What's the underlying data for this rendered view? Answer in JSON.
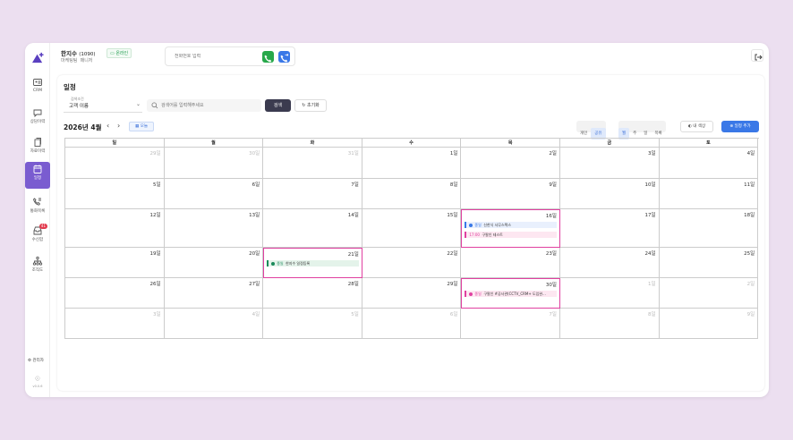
{
  "sidebar": {
    "items": [
      {
        "icon": "contact-card-icon",
        "label": "CRM"
      },
      {
        "icon": "chat-bubble-icon",
        "label": "상담이력"
      },
      {
        "icon": "document-copy-icon",
        "label": "자료이력"
      },
      {
        "icon": "calendar-icon",
        "label": "일정"
      },
      {
        "icon": "phone-list-icon",
        "label": "통화목록"
      },
      {
        "icon": "inbox-icon",
        "label": "수신함",
        "badge": "41"
      },
      {
        "icon": "org-chart-icon",
        "label": "조직도"
      }
    ],
    "admin_label": "관리자",
    "version_label": "v0.0.6",
    "active_index": 3
  },
  "header": {
    "user_name": "한지수",
    "user_ext": "(1090)",
    "user_team": "마케팅팀",
    "user_role": "매니저",
    "status": "온라인",
    "dial_placeholder": "전화번호 입력"
  },
  "page": {
    "title": "일정",
    "condition_label": "검색조건",
    "condition_value": "고객 이름",
    "search_placeholder": "검색어를 입력해주세요",
    "search_btn": "검색",
    "reset_btn": "초기화",
    "month_label": "2026년 4월",
    "prev": "‹",
    "next": "›",
    "today_btn": "오늘",
    "scope_tabs": [
      {
        "label": "개인",
        "on": false
      },
      {
        "label": "공유",
        "on": true
      }
    ],
    "view_tabs": [
      {
        "label": "월",
        "on": true
      },
      {
        "label": "주",
        "on": false
      },
      {
        "label": "일",
        "on": false
      },
      {
        "label": "목록",
        "on": false
      }
    ],
    "color_btn": "내 색상",
    "add_btn": "일정 추가"
  },
  "calendar": {
    "weekdays": [
      "일",
      "월",
      "화",
      "수",
      "목",
      "금",
      "토"
    ],
    "weeks": [
      [
        {
          "d": "29일",
          "o": true
        },
        {
          "d": "30일",
          "o": true
        },
        {
          "d": "31일",
          "o": true
        },
        {
          "d": "1일"
        },
        {
          "d": "2일"
        },
        {
          "d": "3일"
        },
        {
          "d": "4일"
        }
      ],
      [
        {
          "d": "5일"
        },
        {
          "d": "6일"
        },
        {
          "d": "7일"
        },
        {
          "d": "8일"
        },
        {
          "d": "9일"
        },
        {
          "d": "10일"
        },
        {
          "d": "11일"
        }
      ],
      [
        {
          "d": "12일"
        },
        {
          "d": "13일"
        },
        {
          "d": "14일"
        },
        {
          "d": "15일"
        },
        {
          "d": "16일",
          "hl": true,
          "events": [
            {
              "tag": "종일",
              "text": "신한식 사무스택스",
              "color": "#3a78e7",
              "bg": "#e9f0fd"
            },
            {
              "tag": "17:00",
              "text": "구팔인 테스트",
              "color": "#e040a0",
              "bg": "#fde7f1",
              "time": true
            }
          ]
        },
        {
          "d": "17일"
        },
        {
          "d": "18일"
        }
      ],
      [
        {
          "d": "19일"
        },
        {
          "d": "20일"
        },
        {
          "d": "21일",
          "hl": true,
          "events": [
            {
              "tag": "종일",
              "text": "한지수 일정등록",
              "color": "#1a8a5a",
              "bg": "#e4f3ea"
            }
          ]
        },
        {
          "d": "22일"
        },
        {
          "d": "23일"
        },
        {
          "d": "24일"
        },
        {
          "d": "25일"
        }
      ],
      [
        {
          "d": "26일"
        },
        {
          "d": "27일"
        },
        {
          "d": "28일"
        },
        {
          "d": "29일"
        },
        {
          "d": "30일",
          "hl": true,
          "events": [
            {
              "tag": "종일",
              "text": "구팔인 #공사관(CCTV_CRM+ 도입완...",
              "color": "#e040a0",
              "bg": "#fde7f1"
            }
          ]
        },
        {
          "d": "1일",
          "o": true
        },
        {
          "d": "2일",
          "o": true
        }
      ],
      [
        {
          "d": "3일",
          "o": true
        },
        {
          "d": "4일",
          "o": true
        },
        {
          "d": "5일",
          "o": true
        },
        {
          "d": "6일",
          "o": true
        },
        {
          "d": "7일",
          "o": true
        },
        {
          "d": "8일",
          "o": true
        },
        {
          "d": "9일",
          "o": true
        }
      ]
    ]
  }
}
